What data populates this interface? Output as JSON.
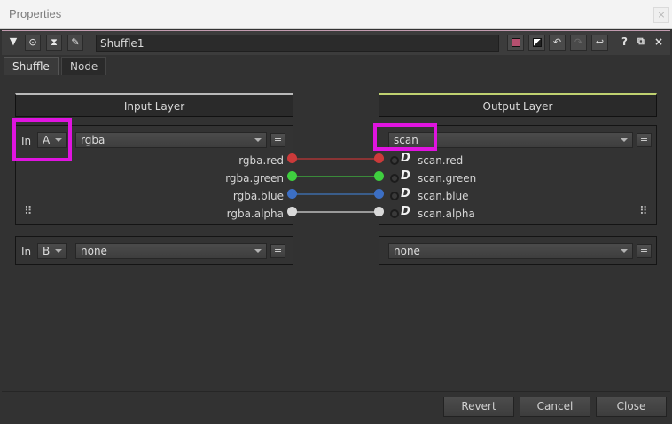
{
  "window": {
    "title": "Properties",
    "close_glyph": "×"
  },
  "toolbar": {
    "node_name": "Shuffle1",
    "help_label": "?",
    "float_label": "⧉",
    "close_label": "×"
  },
  "tabs": [
    {
      "label": "Shuffle",
      "active": true
    },
    {
      "label": "Node",
      "active": false
    }
  ],
  "input_layer": {
    "header": "Input Layer",
    "in_a": {
      "label": "In",
      "input": "A",
      "layer": "rgba",
      "eq": "="
    },
    "channels": [
      "rgba.red",
      "rgba.green",
      "rgba.blue",
      "rgba.alpha"
    ],
    "in_b": {
      "label": "In",
      "input": "B",
      "layer": "none",
      "eq": "="
    }
  },
  "output_layer": {
    "header": "Output Layer",
    "layer": "scan",
    "eq": "=",
    "channels": [
      "scan.red",
      "scan.green",
      "scan.blue",
      "scan.alpha"
    ],
    "layer2": "none",
    "eq2": "="
  },
  "channel_colors": [
    "#cc3a3a",
    "#3fcf3f",
    "#3c6fc4",
    "#d9d9d9"
  ],
  "wire_colors": [
    "#8a3434",
    "#3a8a3a",
    "#3a5d8a",
    "#9a9a9a"
  ],
  "buttons": {
    "revert": "Revert",
    "cancel": "Cancel",
    "close": "Close"
  },
  "highlight_color": "#e014e0"
}
